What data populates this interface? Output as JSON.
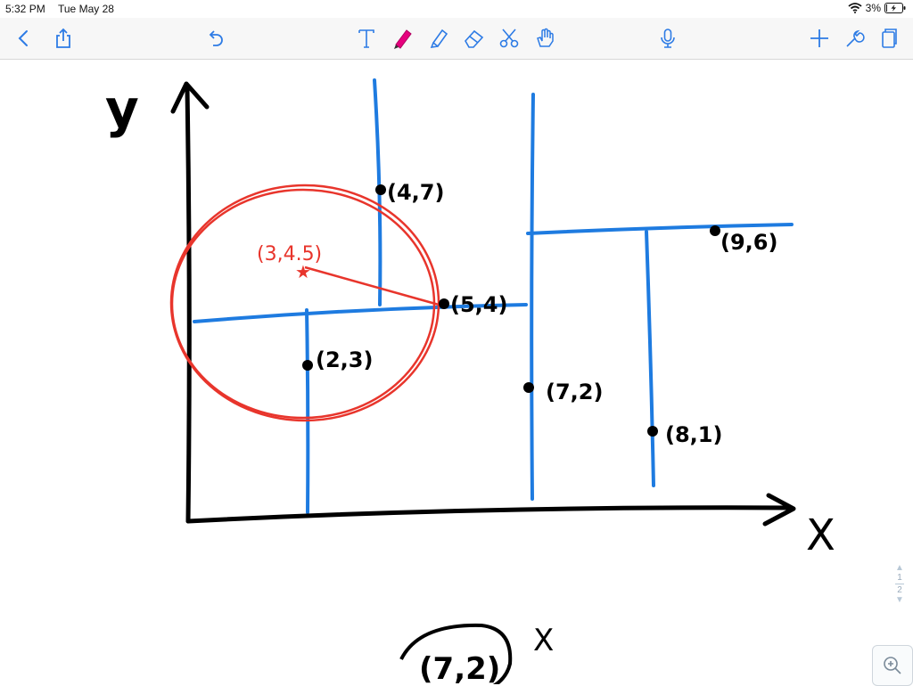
{
  "status": {
    "time": "5:32 PM",
    "date": "Tue May 28",
    "battery_percent": "3%",
    "battery_level": 0.03
  },
  "toolbar": {
    "left": [
      "back-icon",
      "share-icon",
      "undo-icon"
    ],
    "tools": [
      "text-tool-icon",
      "pen-tool-icon",
      "highlighter-tool-icon",
      "eraser-tool-icon",
      "lasso-tool-icon",
      "hand-tool-icon"
    ],
    "center": [
      "microphone-icon"
    ],
    "right": [
      "add-icon",
      "settings-icon",
      "pages-icon"
    ],
    "active_tool": "pen-tool-icon",
    "pen_color": "#e6007e"
  },
  "note": {
    "axis_y_label": "y",
    "axis_x_label": "X",
    "points": [
      {
        "label": "(4,7)",
        "x": 4,
        "y": 7
      },
      {
        "label": "(5,4)",
        "x": 5,
        "y": 4
      },
      {
        "label": "(2,3)",
        "x": 2,
        "y": 3
      },
      {
        "label": "(7,2)",
        "x": 7,
        "y": 2
      },
      {
        "label": "(9,6)",
        "x": 9,
        "y": 6
      },
      {
        "label": "(8,1)",
        "x": 8,
        "y": 1
      }
    ],
    "circle_center_label": "(3,4.5)",
    "bottom_note": "(7,2)",
    "bottom_note_x": "X",
    "colors": {
      "ink": "#000000",
      "split_lines": "#1e7be0",
      "circle": "#e8352c"
    }
  },
  "pages": {
    "current": "1",
    "total": "2"
  }
}
